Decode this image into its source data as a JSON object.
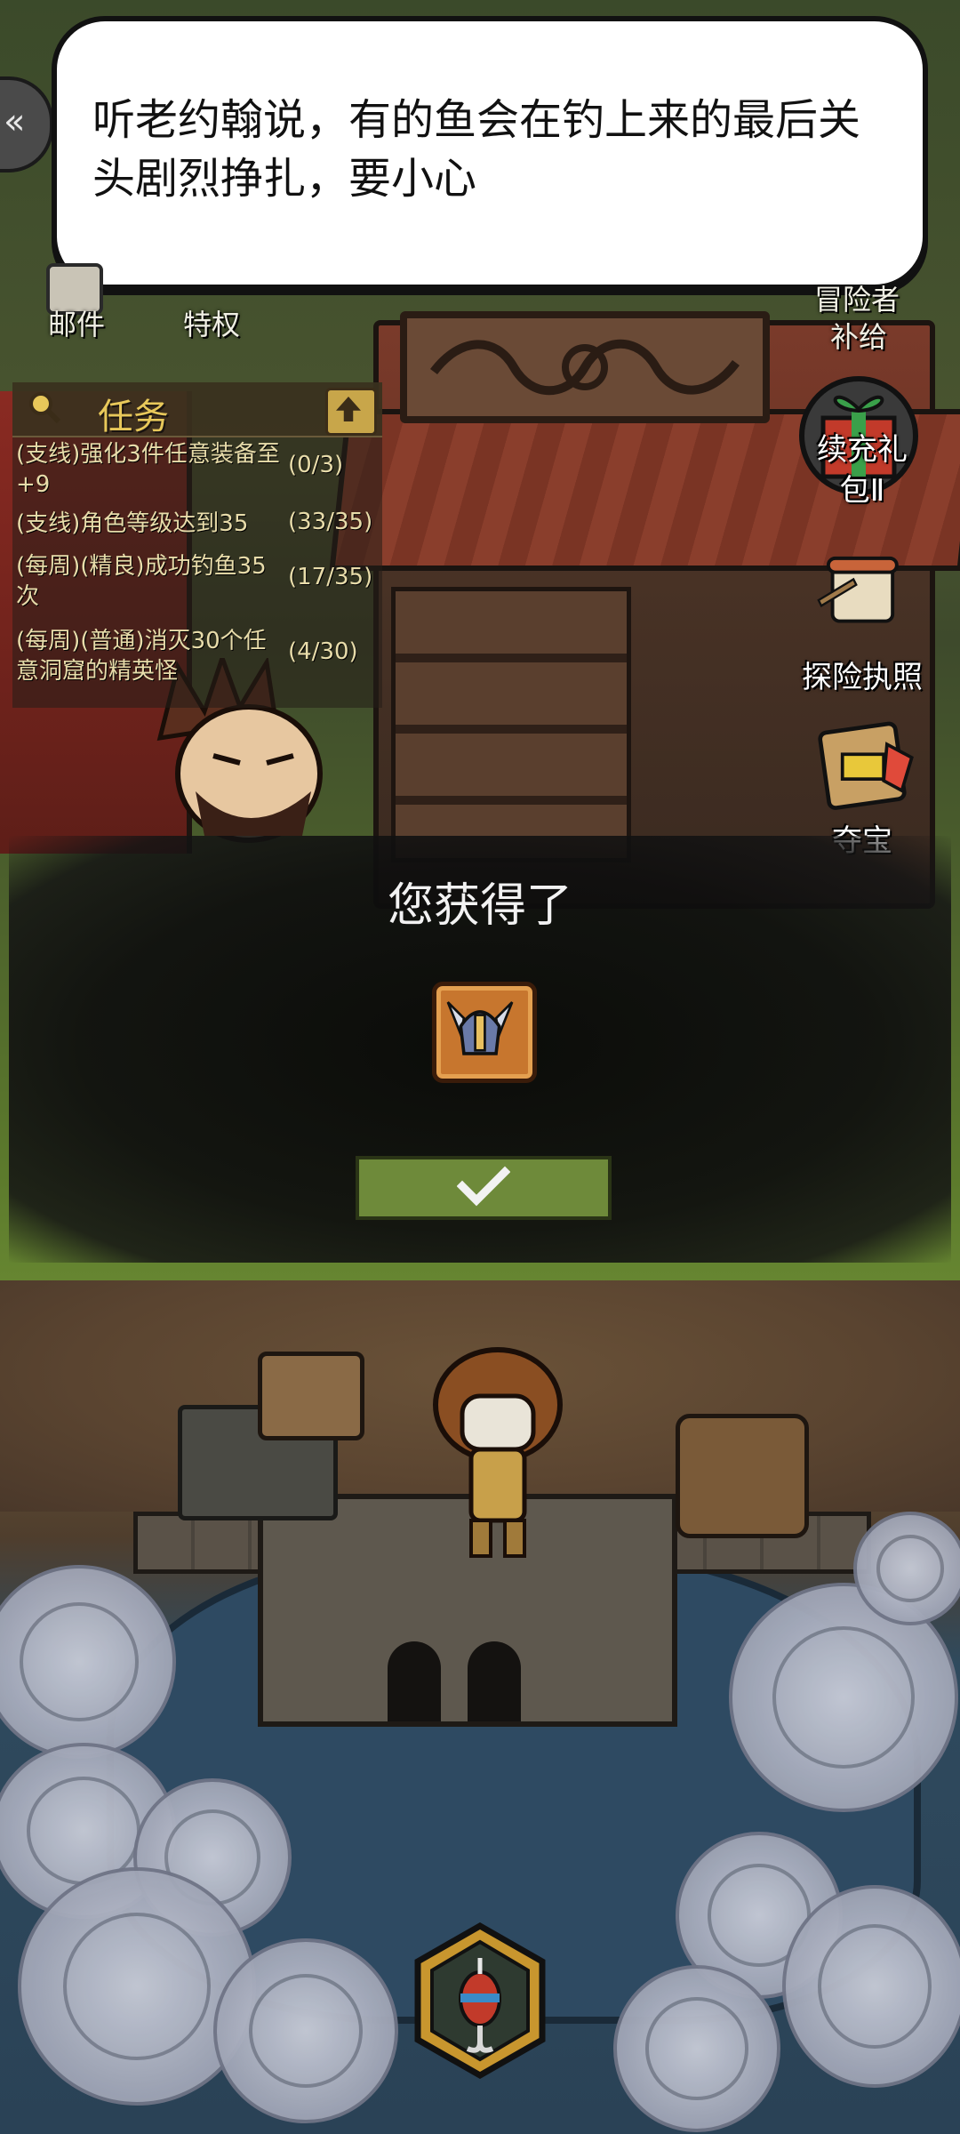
{
  "dialog": {
    "text": "听老约翰说，有的鱼会在钓上来的最后关头剧烈挣扎，要小心"
  },
  "top_icons": {
    "mail_label": "邮件",
    "privilege_label": "特权",
    "supply_label_line1": "冒险者",
    "supply_label_line2": "补给"
  },
  "task_panel": {
    "title": "任务",
    "tasks": [
      {
        "text": "(支线)强化3件任意装备至+9",
        "count": "(0/3)"
      },
      {
        "text": "(支线)角色等级达到35",
        "count": "(33/35)"
      },
      {
        "text": "(每周)(精良)成功钓鱼35次",
        "count": "(17/35)"
      },
      {
        "text": "(每周)(普通)消灭30个任意洞窟的精英怪",
        "count": "(4/30)"
      }
    ]
  },
  "side_buttons": {
    "gift_pack_line1": "续充礼",
    "gift_pack_line2": "包Ⅱ",
    "license_label": "探险执照",
    "treasure_label": "夺宝"
  },
  "reward_popup": {
    "title": "您获得了",
    "item_icon": "winged-helmet-icon"
  },
  "bottom": {
    "fishing_icon": "fishing-bobber-icon"
  },
  "colors": {
    "task_text": "#e8dcaa",
    "task_title": "#e8c85a",
    "confirm_button": "#6e8a3a",
    "reward_frame": "#c7762e"
  }
}
